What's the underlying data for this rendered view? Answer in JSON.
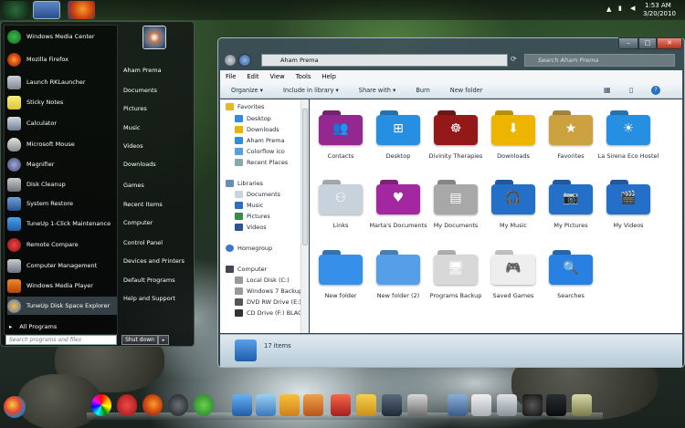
{
  "taskbar": {
    "clock_time": "1:53 AM",
    "clock_date": "3/20/2010"
  },
  "start_menu": {
    "programs": [
      "Windows Media Center",
      "Mozilla Firefox",
      "Launch RKLauncher",
      "Sticky Notes",
      "Calculator",
      "Microsoft Mouse",
      "Magnifier",
      "Disk Cleanup",
      "System Restore",
      "TuneUp 1-Click Maintenance",
      "Remote Compare",
      "Computer Management",
      "Windows Media Player",
      "TuneUp Disk Space Explorer"
    ],
    "all_programs": "All Programs",
    "places": [
      "Aham Prema",
      "Documents",
      "Pictures",
      "Music",
      "Videos",
      "Downloads",
      "Games",
      "Recent Items",
      "Computer",
      "Control Panel",
      "Devices and Printers",
      "Default Programs",
      "Help and Support"
    ],
    "search_placeholder": "Search programs and files",
    "shutdown_label": "Shut down",
    "shutdown_arrow": "▸"
  },
  "explorer": {
    "address": "Aham Prema",
    "search_placeholder": "Search Aham Prema",
    "window_controls": {
      "minimize": "–",
      "maximize": "□",
      "close": "✕"
    },
    "menu": [
      "File",
      "Edit",
      "View",
      "Tools",
      "Help"
    ],
    "commands": [
      "Organize ▾",
      "Include in library ▾",
      "Share with ▾",
      "Burn",
      "New folder"
    ],
    "nav": {
      "favorites_header": "Favorites",
      "favorites": [
        "Desktop",
        "Downloads",
        "Aham Prema",
        "Colorflow ico",
        "Recent Places"
      ],
      "libraries_header": "Libraries",
      "libraries": [
        "Documents",
        "Music",
        "Pictures",
        "Videos"
      ],
      "homegroup": "Homegroup",
      "computer_header": "Computer",
      "drives": [
        "Local Disk (C:)",
        "Windows 7 Backup",
        "DVD RW Drive (E:) N",
        "CD Drive (F:) BLACI"
      ]
    },
    "items": [
      {
        "label": "Contacts",
        "color": "#8e2a8a",
        "glyph": "👥"
      },
      {
        "label": "Desktop",
        "color": "#2f8ed8",
        "glyph": "⊞"
      },
      {
        "label": "Divinity Therapies",
        "color": "#8b1a1a",
        "glyph": "☸"
      },
      {
        "label": "Downloads",
        "color": "#e8b40c",
        "glyph": "⬇"
      },
      {
        "label": "Favorites",
        "color": "#c8a24a",
        "glyph": "★"
      },
      {
        "label": "La Sirena Eco Hostel",
        "color": "#2f8ed8",
        "glyph": "☀"
      },
      {
        "label": "Links",
        "color": "#c9d2db",
        "glyph": "⚇"
      },
      {
        "label": "Marta's Documents",
        "color": "#9c2a9a",
        "glyph": "♥"
      },
      {
        "label": "My Documents",
        "color": "#a8a8a8",
        "glyph": "▤"
      },
      {
        "label": "My Music",
        "color": "#2a6fc0",
        "glyph": "🎧"
      },
      {
        "label": "My Pictures",
        "color": "#2a6fc0",
        "glyph": "📷"
      },
      {
        "label": "My Videos",
        "color": "#2a6fc0",
        "glyph": "🎬"
      },
      {
        "label": "New folder",
        "color": "#3d8fe0",
        "glyph": ""
      },
      {
        "label": "New folder (2)",
        "color": "#5a9ee0",
        "glyph": ""
      },
      {
        "label": "Programs Backup",
        "color": "#d8d8d8",
        "glyph": "🖥"
      },
      {
        "label": "Saved Games",
        "color": "#eeeeee",
        "glyph": "🎮"
      },
      {
        "label": "Searches",
        "color": "#2f7fd8",
        "glyph": "🔍"
      }
    ],
    "status": "17 items"
  }
}
